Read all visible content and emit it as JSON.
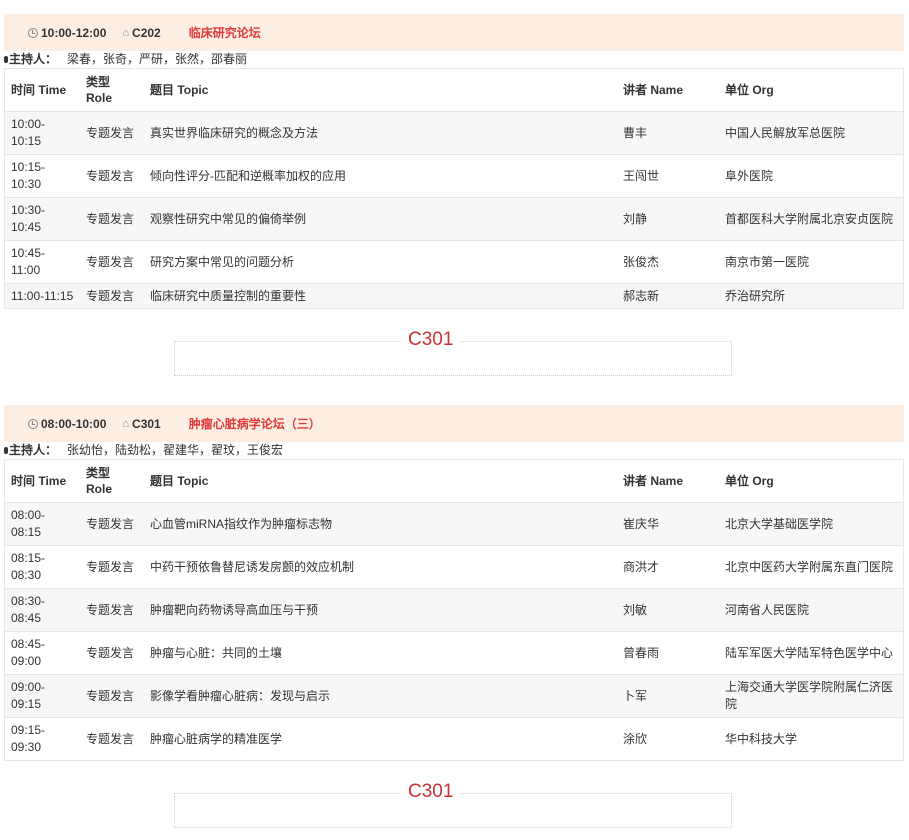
{
  "table_headers": {
    "time": "时间 Time",
    "role": "类型 Role",
    "topic": "题目 Topic",
    "speaker": "讲者 Name",
    "org": "单位 Org"
  },
  "moderator_label": "主持人：",
  "icons": {
    "clock": "clock-icon",
    "room": "home-icon",
    "moderator": "microphone-icon"
  },
  "colors": {
    "header_bg": "#fdeee3",
    "title": "#e03b3b",
    "room_label": "#c83232"
  },
  "sessions": [
    {
      "time": "10:00-12:00",
      "room": "C202",
      "title": "临床研究论坛",
      "moderators": "梁春，张奇，严研，张然，邵春丽",
      "rows": [
        {
          "time": "10:00-10:15",
          "role": "专题发言",
          "topic": "真实世界临床研究的概念及方法",
          "speaker": "曹丰",
          "org": "中国人民解放军总医院"
        },
        {
          "time": "10:15-10:30",
          "role": "专题发言",
          "topic": "倾向性评分-匹配和逆概率加权的应用",
          "speaker": "王闯世",
          "org": "阜外医院"
        },
        {
          "time": "10:30-10:45",
          "role": "专题发言",
          "topic": "观察性研究中常见的偏倚举例",
          "speaker": "刘静",
          "org": "首都医科大学附属北京安贞医院"
        },
        {
          "time": "10:45-11:00",
          "role": "专题发言",
          "topic": "研究方案中常见的问题分析",
          "speaker": "张俊杰",
          "org": "南京市第一医院"
        },
        {
          "time": "11:00-11:15",
          "role": "专题发言",
          "topic": "临床研究中质量控制的重要性",
          "speaker": "郝志新",
          "org": "乔治研究所"
        }
      ]
    },
    {
      "time": "08:00-10:00",
      "room": "C301",
      "title": "肿瘤心脏病学论坛（三）",
      "moderators": "张幼怡，陆劲松，翟建华，翟玟，王俊宏",
      "rows": [
        {
          "time": "08:00-08:15",
          "role": "专题发言",
          "topic": "心血管miRNA指纹作为肿瘤标志物",
          "speaker": "崔庆华",
          "org": "北京大学基础医学院"
        },
        {
          "time": "08:15-08:30",
          "role": "专题发言",
          "topic": "中药干预依鲁替尼诱发房颤的效应机制",
          "speaker": "商洪才",
          "org": "北京中医药大学附属东直门医院"
        },
        {
          "time": "08:30-08:45",
          "role": "专题发言",
          "topic": "肿瘤靶向药物诱导高血压与干预",
          "speaker": "刘敏",
          "org": "河南省人民医院"
        },
        {
          "time": "08:45-09:00",
          "role": "专题发言",
          "topic": "肿瘤与心脏：共同的土壤",
          "speaker": "曾春雨",
          "org": "陆军军医大学陆军特色医学中心"
        },
        {
          "time": "09:00-09:15",
          "role": "专题发言",
          "topic": "影像学看肿瘤心脏病：发现与启示",
          "speaker": "卜军",
          "org": "上海交通大学医学院附属仁济医院"
        },
        {
          "time": "09:15-09:30",
          "role": "专题发言",
          "topic": "肿瘤心脏病学的精准医学",
          "speaker": "涂欣",
          "org": "华中科技大学"
        }
      ]
    }
  ],
  "room_labels": [
    "C301",
    "C301"
  ]
}
